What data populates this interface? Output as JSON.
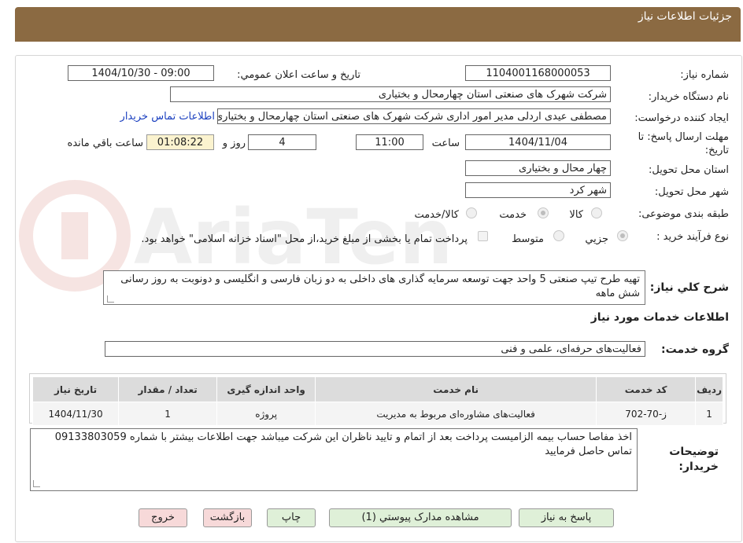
{
  "header": {
    "title": "جزئیات اطلاعات نیاز"
  },
  "form": {
    "need_number_label": "شماره نیاز:",
    "need_number": "1104001168000053",
    "announce_label": "تاریخ و ساعت اعلان عمومي:",
    "announce_value": "1404/10/30 - 09:00",
    "buyer_org_label": "نام دستگاه خریدار:",
    "buyer_org": "شرکت شهرک های صنعتی استان چهارمحال و بختیاری",
    "requester_label": "ایجاد کننده درخواست:",
    "requester": "مصطفی عیدی اردلی مدیر امور اداری شرکت شهرک های صنعتی استان چهارمحال و بختیاری",
    "contact_link": "اطلاعات تماس خریدار",
    "deadline_label_1": "مهلت ارسال پاسخ: تا",
    "deadline_label_2": "تاریخ:",
    "deadline_date": "1404/11/04",
    "time_label": "ساعت",
    "deadline_time": "11:00",
    "days_value": "4",
    "days_label": "روز و",
    "remaining_time": "01:08:22",
    "remaining_label": "ساعت باقي مانده",
    "province_label": "استان محل تحویل:",
    "province": "چهار محال و بختیاری",
    "city_label": "شهر محل تحویل:",
    "city": "شهر کرد",
    "category_label": "طبقه بندی موضوعی:",
    "category_options": [
      "کالا",
      "خدمت",
      "کالا/خدمت"
    ],
    "category_selected": "خدمت",
    "process_label": "نوع فرآیند خرید :",
    "process_options": [
      "جزیي",
      "متوسط"
    ],
    "process_selected": "جزیي",
    "payment_note": "پرداخت تمام یا بخشی از مبلغ خرید،از محل \"اسناد خزانه اسلامی\" خواهد بود.",
    "description_label": "شرح كلي نیاز:",
    "description": "تهیه طرح تیپ صنعتی 5 واحد جهت توسعه سرمایه گذاری های داخلی به دو زبان فارسی و انگلیسی و دونوبت به روز رسانی شش ماهه"
  },
  "services": {
    "section_title": "اطلاعات خدمات مورد نیاز",
    "group_label": "گروه خدمت:",
    "group_value": "فعالیت‌های حرفه‌ای، علمی و فنی",
    "columns": [
      "ردیف",
      "کد خدمت",
      "نام خدمت",
      "واحد اندازه گیری",
      "تعداد / مقدار",
      "تاریخ نیاز"
    ],
    "rows": [
      [
        "1",
        "ز-70-702",
        "فعالیت‌های مشاوره‌ای مربوط به مدیریت",
        "پروژه",
        "1",
        "1404/11/30"
      ]
    ]
  },
  "notes": {
    "label_1": "توضیحات",
    "label_2": "خریدار:",
    "text": "اخذ مفاصا حساب بیمه الزامیست پرداخت بعد از اتمام و تایید ناظران این شرکت میباشد جهت اطلاعات بیشتر با شماره 09133803059 تماس حاصل فرمایید"
  },
  "buttons": {
    "reply": "پاسخ به نیاز",
    "attachments": "مشاهده مدارک پیوستي (1)",
    "print": "چاپ",
    "back": "بازگشت",
    "exit": "خروج"
  },
  "colors": {
    "header": "#8b6a42",
    "timer_bg": "#fbf3cf",
    "link": "#1a3fbf",
    "button_green": "#dff0d8",
    "button_pink": "#f7d9d9"
  }
}
